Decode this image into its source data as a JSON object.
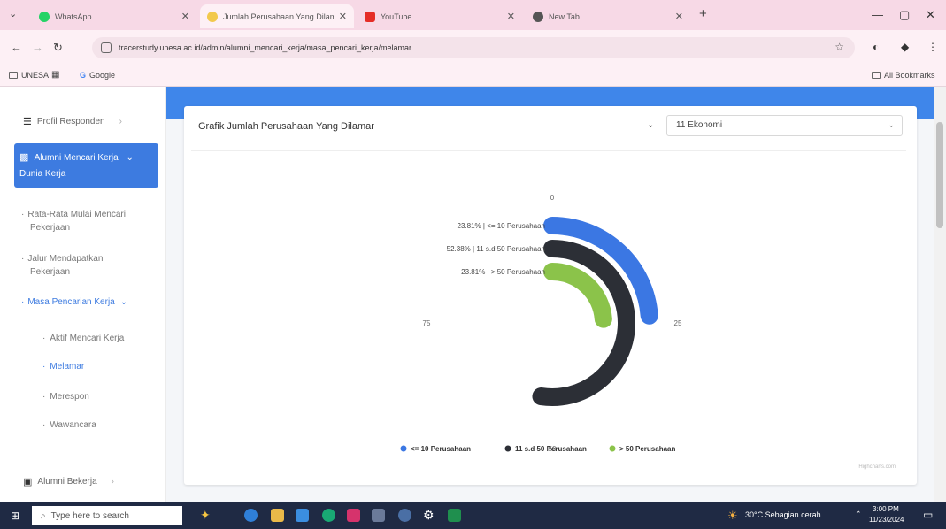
{
  "browser": {
    "tabs": [
      {
        "label": "WhatsApp",
        "active": false,
        "color": "#25d366"
      },
      {
        "label": "Jumlah Perusahaan Yang Dilam",
        "active": true,
        "color": "#f2c94c"
      },
      {
        "label": "YouTube",
        "active": false,
        "color": "#e52d27"
      },
      {
        "label": "New Tab",
        "active": false,
        "color": "#555555"
      }
    ],
    "new_tab_glyph": "+",
    "url": "tracerstudy.unesa.ac.id/admin/alumni_mencari_kerja/masa_pencari_kerja/melamar",
    "bookmarks": [
      "UNESA",
      "Google"
    ],
    "all_bookmarks": "All Bookmarks"
  },
  "sidebar": {
    "profil": "Profil Responden",
    "active_item": "Alumni Mencari Kerja",
    "active_line2": "Dunia Kerja",
    "sub_items": [
      {
        "label": "Rata-Rata Mulai Mencari Pekerjaan"
      },
      {
        "label": "Jalur Mendapatkan Pekerjaan"
      },
      {
        "label": "Masa Pencarian Kerja"
      }
    ],
    "sub_sub_items": [
      {
        "label": "Aktif Mencari Kerja",
        "active": false
      },
      {
        "label": "Melamar",
        "active": true
      },
      {
        "label": "Merespon",
        "active": false
      },
      {
        "label": "Wawancara",
        "active": false
      }
    ],
    "bottom_item": "Alumni Bekerja"
  },
  "card": {
    "title": "Grafik Jumlah Perusahaan Yang Dilamar",
    "select_value": "11 Ekonomi",
    "credit": "Highcharts.com"
  },
  "chart_data": {
    "type": "radial-bar",
    "title": "Grafik Jumlah Perusahaan Yang Dilamar",
    "axis_ticks": [
      "0",
      "25",
      "50",
      "75"
    ],
    "axis_max": 100,
    "series": [
      {
        "name": "<= 10 Perusahaan",
        "value": 23.81,
        "label": "23.81% | <= 10 Perusahaan",
        "color": "#3b77e3"
      },
      {
        "name": "11 s.d 50 Perusahaan",
        "value": 52.38,
        "label": "52.38% | 11 s.d 50 Perusahaan",
        "color": "#2c2f36"
      },
      {
        "name": "> 50 Perusahaan",
        "value": 23.81,
        "label": "23.81% | > 50 Perusahaan",
        "color": "#8bc34a"
      }
    ],
    "legend_position": "bottom"
  },
  "taskbar": {
    "search_placeholder": "Type here to search",
    "weather": "30°C  Sebagian cerah",
    "time": "3:00 PM",
    "date": "11/23/2024"
  }
}
